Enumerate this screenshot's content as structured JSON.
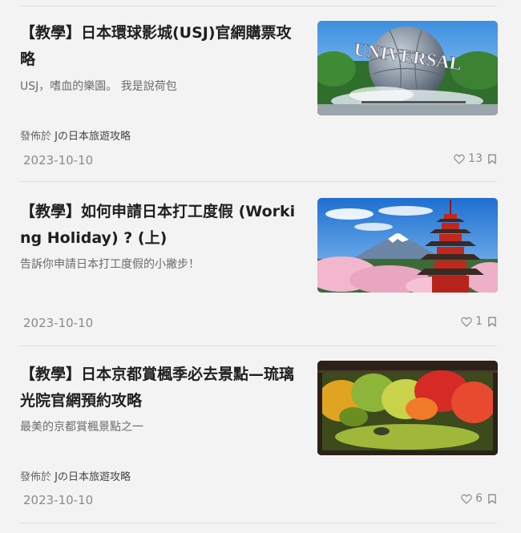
{
  "posts": [
    {
      "title": "【教學】日本環球影城(USJ)官網購票攻略",
      "excerpt": "USJ，嗜血的樂園。 我是說荷包",
      "source_prefix": "發佈於",
      "source_blog": "Jの日本旅遊攻略",
      "date": "2023-10-10",
      "likes": "13",
      "image_text": "UNIVERSAL",
      "icons": [
        "heart-icon",
        "bookmark-icon"
      ]
    },
    {
      "title": "【教學】如何申請日本打工度假 (Working Holiday) ? (上)",
      "excerpt": "告訴你申請日本打工度假的小撇步！",
      "date": "2023-10-10",
      "likes": "1",
      "icons": [
        "heart-icon",
        "bookmark-icon"
      ]
    },
    {
      "title": "【教學】日本京都賞楓季必去景點—琉璃光院官網預約攻略",
      "excerpt": "最美的京都賞楓景點之一",
      "source_prefix": "發佈於",
      "source_blog": "Jの日本旅遊攻略",
      "date": "2023-10-10",
      "likes": "6",
      "icons": [
        "heart-icon",
        "bookmark-icon"
      ]
    }
  ],
  "colors": {
    "background": "#f3f3f3",
    "divider": "#dedede",
    "title": "#1f1f1f",
    "muted": "#8a8a8a"
  }
}
